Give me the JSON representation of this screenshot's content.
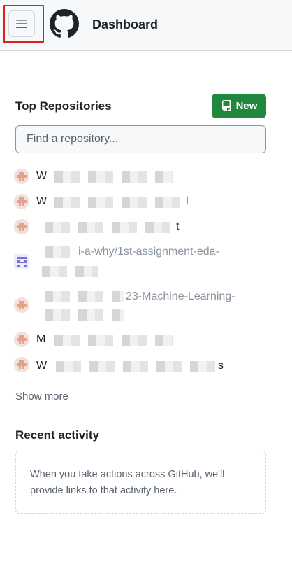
{
  "header": {
    "title": "Dashboard",
    "menu_icon": "hamburger-icon",
    "logo_icon": "github-logo-icon"
  },
  "repositories": {
    "section_title": "Top Repositories",
    "new_button_label": "New",
    "new_button_icon": "repo-icon",
    "search_placeholder": "Find a repository...",
    "items": [
      {
        "label_start": "W",
        "label_visible": "W▒g▒u▒/▒▒▒▒▒▒▒",
        "name_fragment": ""
      },
      {
        "label_start": "W",
        "label_visible": "",
        "name_fragment": "l"
      },
      {
        "label_start": "",
        "label_visible": "",
        "name_fragment": "t"
      },
      {
        "label_start": "",
        "label_visible": "",
        "name_fragment": "i-a-why/1st-assignment-eda-"
      },
      {
        "label_start": "",
        "label_visible": "",
        "name_fragment": "23-Machine-Learning-"
      },
      {
        "label_start": "M",
        "label_visible": "",
        "name_fragment": ""
      },
      {
        "label_start": "W",
        "label_visible": "",
        "name_fragment": "s"
      }
    ],
    "show_more": "Show more"
  },
  "recent_activity": {
    "title": "Recent activity",
    "empty_text_line1": "When you take actions across GitHub, we'll",
    "empty_text_line2": "provide links to that activity here."
  },
  "colors": {
    "accent_green": "#1f883d",
    "highlight_red": "#e11d1d",
    "header_bg": "#f6f8fa"
  }
}
